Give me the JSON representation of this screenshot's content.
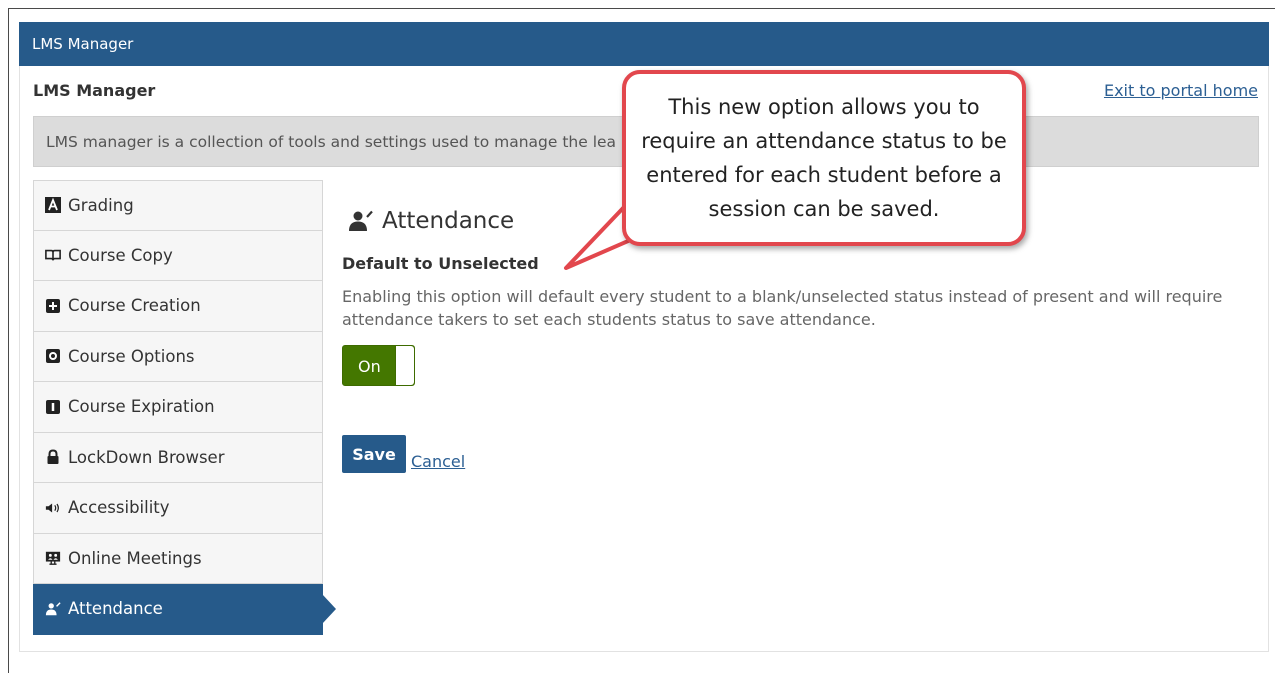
{
  "header": {
    "title": "LMS Manager"
  },
  "page": {
    "subtitle": "LMS Manager",
    "exit_link": "Exit to portal home",
    "description": "LMS manager is a collection of tools and settings used to manage the lea"
  },
  "sidebar": {
    "items": [
      {
        "label": "Grading",
        "icon": "grading-a-icon",
        "active": false
      },
      {
        "label": "Course Copy",
        "icon": "book-icon",
        "active": false
      },
      {
        "label": "Course Creation",
        "icon": "course-creation-icon",
        "active": false
      },
      {
        "label": "Course Options",
        "icon": "course-options-icon",
        "active": false
      },
      {
        "label": "Course Expiration",
        "icon": "course-expiration-icon",
        "active": false
      },
      {
        "label": "LockDown Browser",
        "icon": "lock-icon",
        "active": false
      },
      {
        "label": "Accessibility",
        "icon": "speaker-icon",
        "active": false
      },
      {
        "label": "Online Meetings",
        "icon": "meeting-icon",
        "active": false
      },
      {
        "label": "Attendance",
        "icon": "attendance-icon",
        "active": true
      }
    ]
  },
  "main": {
    "heading": "Attendance",
    "option_title": "Default to Unselected",
    "option_description": "Enabling this option will default every student to a blank/unselected status instead of present and will require attendance takers to set each students status to save attendance.",
    "toggle": {
      "label": "On",
      "state": true
    },
    "save_label": "Save",
    "cancel_label": "Cancel"
  },
  "callout": {
    "text": "This new option allows you to require an attendance status to be entered for each student before a session can be saved."
  },
  "colors": {
    "brand": "#265a8a",
    "toggle_on": "#447700",
    "callout_border": "#e2474d"
  }
}
